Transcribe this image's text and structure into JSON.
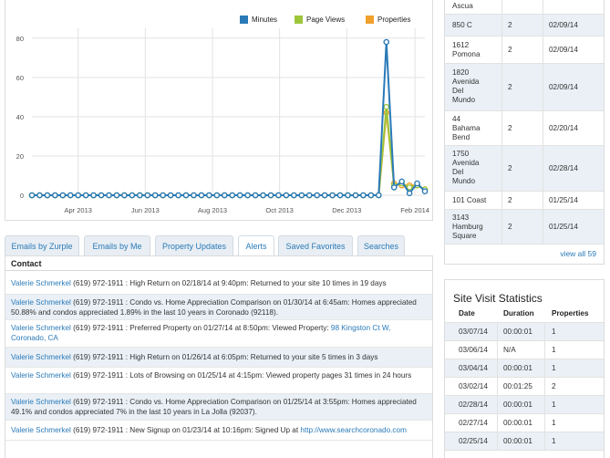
{
  "colors": {
    "minutes": "#2a7ab8",
    "page_views": "#9dc63b",
    "properties": "#f0a12c",
    "link": "#2a7ab8"
  },
  "chart_data": {
    "type": "line",
    "x": [
      "2013-02-18",
      "2013-02-25",
      "2013-03-04",
      "2013-03-11",
      "2013-03-18",
      "2013-03-25",
      "2013-04-01",
      "2013-04-08",
      "2013-04-15",
      "2013-04-22",
      "2013-04-29",
      "2013-05-06",
      "2013-05-13",
      "2013-05-20",
      "2013-05-27",
      "2013-06-03",
      "2013-06-10",
      "2013-06-17",
      "2013-06-24",
      "2013-07-01",
      "2013-07-08",
      "2013-07-15",
      "2013-07-22",
      "2013-07-29",
      "2013-08-05",
      "2013-08-12",
      "2013-08-19",
      "2013-08-26",
      "2013-09-02",
      "2013-09-09",
      "2013-09-16",
      "2013-09-23",
      "2013-09-30",
      "2013-10-07",
      "2013-10-14",
      "2013-10-21",
      "2013-10-28",
      "2013-11-04",
      "2013-11-11",
      "2013-11-18",
      "2013-11-25",
      "2013-12-02",
      "2013-12-09",
      "2013-12-16",
      "2013-12-23",
      "2013-12-30",
      "2014-01-06",
      "2014-01-13",
      "2014-01-20",
      "2014-01-27",
      "2014-02-03",
      "2014-02-10"
    ],
    "series": [
      {
        "name": "Minutes",
        "color": "#2a7ab8",
        "values": [
          0,
          0,
          0,
          0,
          0,
          0,
          0,
          0,
          0,
          0,
          0,
          0,
          0,
          0,
          0,
          0,
          0,
          0,
          0,
          0,
          0,
          0,
          0,
          0,
          0,
          0,
          0,
          0,
          0,
          0,
          0,
          0,
          0,
          0,
          0,
          0,
          0,
          0,
          0,
          0,
          0,
          0,
          0,
          0,
          0,
          0,
          78,
          4,
          7,
          1,
          6,
          2
        ]
      },
      {
        "name": "Page Views",
        "color": "#9dc63b",
        "values": [
          0,
          0,
          0,
          0,
          0,
          0,
          0,
          0,
          0,
          0,
          0,
          0,
          0,
          0,
          0,
          0,
          0,
          0,
          0,
          0,
          0,
          0,
          0,
          0,
          0,
          0,
          0,
          0,
          0,
          0,
          0,
          0,
          0,
          0,
          0,
          0,
          0,
          0,
          0,
          0,
          0,
          0,
          0,
          0,
          0,
          0,
          45,
          5,
          6,
          4,
          5,
          3
        ]
      },
      {
        "name": "Properties",
        "color": "#f0a12c",
        "values": [
          0,
          0,
          0,
          0,
          0,
          0,
          0,
          0,
          0,
          0,
          0,
          0,
          0,
          0,
          0,
          0,
          0,
          0,
          0,
          0,
          0,
          0,
          0,
          0,
          0,
          0,
          0,
          0,
          0,
          0,
          0,
          0,
          0,
          0,
          0,
          0,
          0,
          0,
          0,
          0,
          0,
          0,
          0,
          0,
          0,
          0,
          42,
          6,
          5,
          5,
          5,
          3
        ]
      }
    ],
    "xticks": [
      {
        "label": "Apr 2013",
        "x": "2013-04-01"
      },
      {
        "label": "Jun 2013",
        "x": "2013-06-01"
      },
      {
        "label": "Aug 2013",
        "x": "2013-08-01"
      },
      {
        "label": "Oct 2013",
        "x": "2013-10-01"
      },
      {
        "label": "Dec 2013",
        "x": "2013-12-01"
      },
      {
        "label": "Feb 2014",
        "x": "2014-02-01"
      }
    ],
    "yticks": [
      0,
      20,
      40,
      60,
      80
    ],
    "ylim": [
      0,
      85
    ],
    "grid": true,
    "legend_position": "top-right",
    "title": "",
    "xlabel": "",
    "ylabel": ""
  },
  "tabs": [
    {
      "label": "Emails by Zurple",
      "active": false
    },
    {
      "label": "Emails by Me",
      "active": false
    },
    {
      "label": "Property Updates",
      "active": false
    },
    {
      "label": "Alerts",
      "active": true
    },
    {
      "label": "Saved Favorites",
      "active": false
    },
    {
      "label": "Searches",
      "active": false
    }
  ],
  "activity": {
    "header": "Contact",
    "rows": [
      {
        "name": "Valerie Schmerkel",
        "text": " (619) 972-1911 : High Return on 02/18/14 at 9:40pm: Returned to your site 10 times in 19 days"
      },
      {
        "name": "Valerie Schmerkel",
        "text": " (619) 972-1911 : Condo vs. Home Appreciation Comparison on 01/30/14 at 6:45am: Homes appreciated 50.88% and condos appreciated 1.89% in the last 10 years in Coronado (92118)."
      },
      {
        "name": "Valerie Schmerkel",
        "text": " (619) 972-1911 : Preferred Property on 01/27/14 at 8:50pm: Viewed Property: ",
        "link": "98 Kingston Ct W, Coronado, CA"
      },
      {
        "name": "Valerie Schmerkel",
        "text": " (619) 972-1911 : High Return on 01/26/14 at 6:05pm: Returned to your site 5 times in 3 days"
      },
      {
        "name": "Valerie Schmerkel",
        "text": " (619) 972-1911 : Lots of Browsing on 01/25/14 at 4:15pm: Viewed property pages 31 times in 24 hours"
      },
      {
        "name": "Valerie Schmerkel",
        "text": " (619) 972-1911 : Condo vs. Home Appreciation Comparison on 01/25/14 at 3:55pm: Homes appreciated 49.1% and condos appreciated 7% in the last 10 years in La Jolla (92037)."
      },
      {
        "name": "Valerie Schmerkel",
        "text": " (619) 972-1911 : New Signup on 01/23/14 at 10:16pm: Signed Up at ",
        "link": "http://www.searchcoronado.com"
      }
    ]
  },
  "properties": {
    "rows": [
      {
        "address": "Ascua",
        "count": "",
        "date": ""
      },
      {
        "address": "850 C",
        "count": "2",
        "date": "02/09/14"
      },
      {
        "address": "1612\nPomona",
        "count": "2",
        "date": "02/09/14"
      },
      {
        "address": "1820\nAvenida\nDel\nMundo",
        "count": "2",
        "date": "02/09/14"
      },
      {
        "address": "44\nBahama\nBend",
        "count": "2",
        "date": "02/20/14"
      },
      {
        "address": "1750\nAvenida\nDel\nMundo",
        "count": "2",
        "date": "02/28/14"
      },
      {
        "address": "101 Coast",
        "count": "2",
        "date": "01/25/14"
      },
      {
        "address": "3143\nHamburg\nSquare",
        "count": "2",
        "date": "01/25/14"
      }
    ],
    "view_all": "view all 59"
  },
  "site_visits": {
    "title": "Site Visit Statistics",
    "headers": {
      "date": "Date",
      "duration": "Duration",
      "properties": "Properties"
    },
    "rows": [
      {
        "date": "03/07/14",
        "duration": "00:00:01",
        "properties": "1"
      },
      {
        "date": "03/06/14",
        "duration": "N/A",
        "properties": "1"
      },
      {
        "date": "03/04/14",
        "duration": "00:00:01",
        "properties": "1"
      },
      {
        "date": "03/02/14",
        "duration": "00:01:25",
        "properties": "2"
      },
      {
        "date": "02/28/14",
        "duration": "00:00:01",
        "properties": "1"
      },
      {
        "date": "02/27/14",
        "duration": "00:00:01",
        "properties": "1"
      },
      {
        "date": "02/25/14",
        "duration": "00:00:01",
        "properties": "1"
      }
    ]
  }
}
